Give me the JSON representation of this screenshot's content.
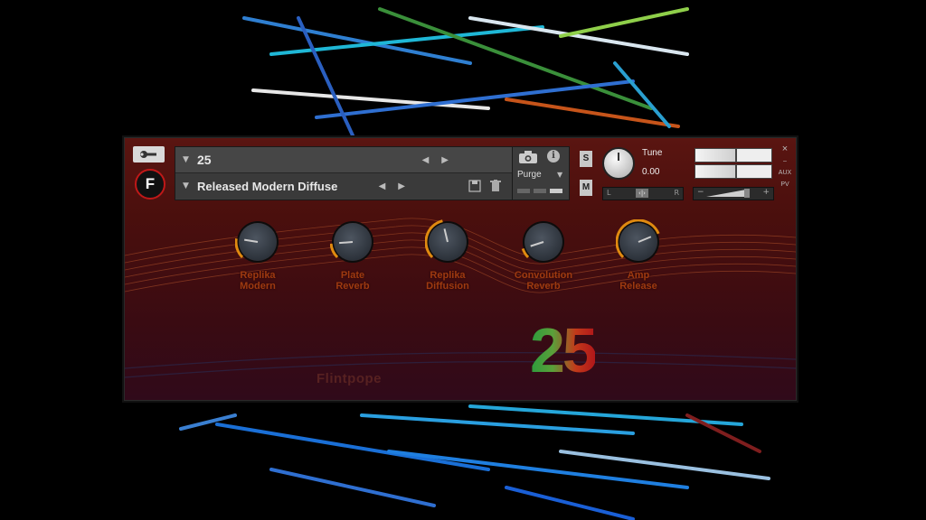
{
  "instrument": {
    "slot_number": "25",
    "preset_name": "Released Modern Diffuse"
  },
  "purge": {
    "label": "Purge"
  },
  "buttons": {
    "solo": "S",
    "mute": "M"
  },
  "tune": {
    "label": "Tune",
    "value": "0.00"
  },
  "pan": {
    "left": "L",
    "right": "R",
    "center": "‹|›"
  },
  "volume": {
    "minus": "−",
    "plus": "+"
  },
  "side": {
    "close": "×",
    "minimize": "–",
    "aux": "AUX",
    "pv": "PV"
  },
  "knobs": [
    {
      "line1": "Replika",
      "line2": "Modern",
      "level": 0.2
    },
    {
      "line1": "Plate",
      "line2": "Reverb",
      "level": 0.15
    },
    {
      "line1": "Replika",
      "line2": "Diffusion",
      "level": 0.45
    },
    {
      "line1": "Convolution",
      "line2": "Reverb",
      "level": 0.1
    },
    {
      "line1": "Amp",
      "line2": "Release",
      "level": 0.75
    }
  ],
  "branding": {
    "maker": "Flintpope",
    "big_number": "25"
  },
  "colors": {
    "accent": "#e08a10",
    "panel": "#4a0f0d",
    "label": "#9e3a10"
  },
  "icons": [
    "wrench-icon",
    "logo-f-icon",
    "camera-icon",
    "info-icon",
    "save-icon",
    "trash-icon"
  ]
}
